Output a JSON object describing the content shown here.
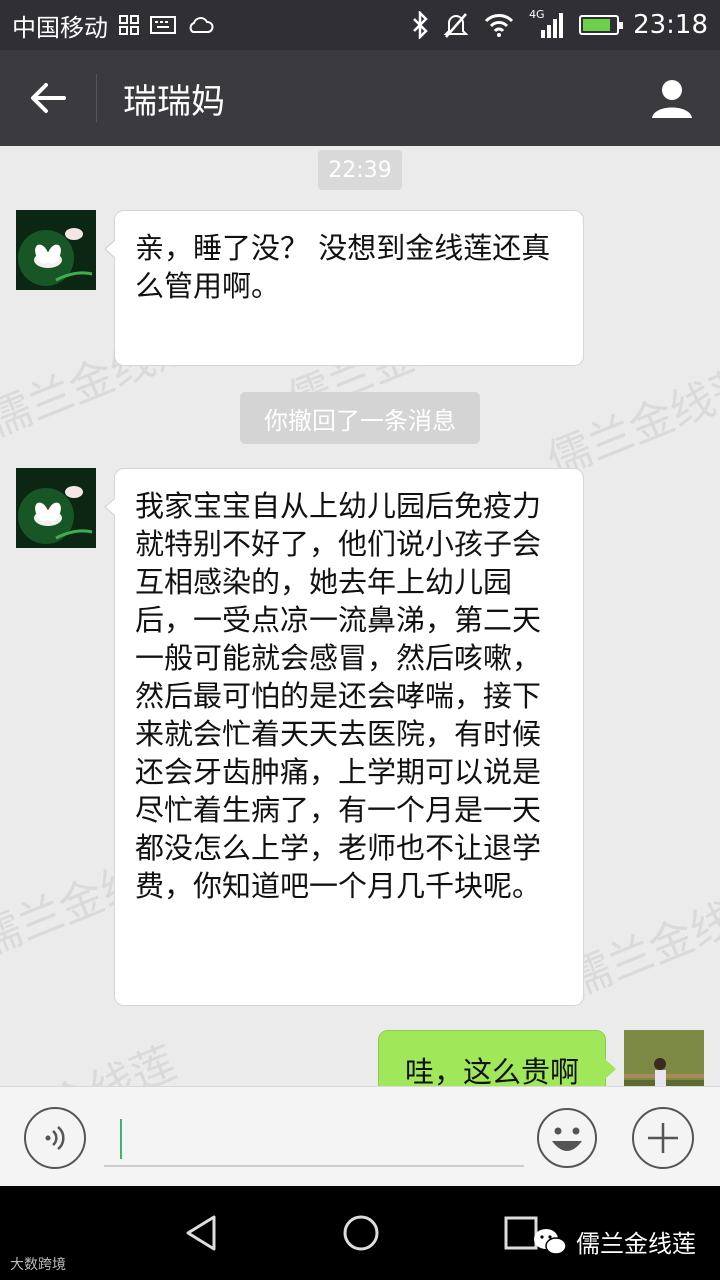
{
  "status_bar": {
    "carrier": "中国移动",
    "network": "4G",
    "time": "23:18"
  },
  "header": {
    "title": "瑞瑞妈"
  },
  "chat": {
    "timestamp": "22:39",
    "messages": [
      {
        "side": "left",
        "text": "亲，睡了没？ 没想到金线莲还真么管用啊。"
      },
      {
        "side": "left",
        "text": "我家宝宝自从上幼儿园后免疫力就特别不好了，他们说小孩子会互相感染的，她去年上幼儿园后，一受点凉一流鼻涕，第二天一般可能就会感冒，然后咳嗽，然后最可怕的是还会哮喘，接下来就会忙着天天去医院，有时候还会牙齿肿痛，上学期可以说是尽忙着生病了，有一个月是一天都没怎么上学，老师也不让退学费，你知道吧一个月几千块呢。"
      },
      {
        "side": "right",
        "text": "哇，这么贵啊"
      }
    ],
    "recall_notice": "你撤回了一条消息",
    "watermark": "儒兰金线莲"
  },
  "input_bar": {
    "value": ""
  },
  "footer": {
    "brand": "儒兰金线莲",
    "corner_mark": "大数跨境"
  },
  "colors": {
    "status_bar": "#2f2f35",
    "nav_bar": "#3a3a3f",
    "chat_bg": "#ebebeb",
    "my_bubble": "#a0e75a"
  }
}
